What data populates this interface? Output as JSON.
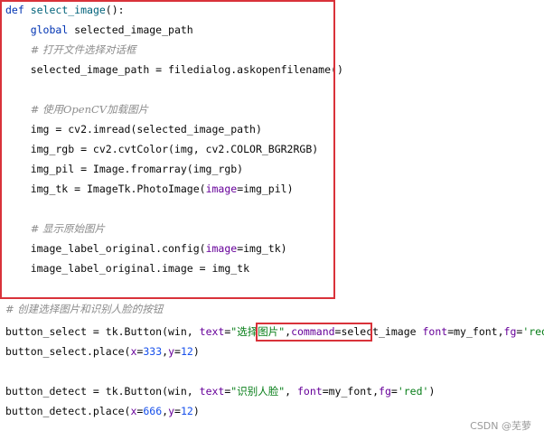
{
  "code_lines": [
    {
      "tokens": [
        {
          "t": "def ",
          "c": "kw"
        },
        {
          "t": "select_image",
          "c": "fn"
        },
        {
          "t": "():",
          "c": ""
        }
      ]
    },
    {
      "tokens": [
        {
          "t": "    ",
          "c": ""
        },
        {
          "t": "global ",
          "c": "kw"
        },
        {
          "t": "selected_image_path",
          "c": ""
        }
      ]
    },
    {
      "tokens": [
        {
          "t": "    ",
          "c": ""
        },
        {
          "t": "# 打开文件选择对话框",
          "c": "cmt"
        }
      ]
    },
    {
      "tokens": [
        {
          "t": "    selected_image_path = filedialog.askopenfilename()",
          "c": ""
        }
      ]
    },
    {
      "tokens": [
        {
          "t": "",
          "c": ""
        }
      ]
    },
    {
      "tokens": [
        {
          "t": "    ",
          "c": ""
        },
        {
          "t": "# 使用OpenCV加载图片",
          "c": "cmt"
        }
      ]
    },
    {
      "tokens": [
        {
          "t": "    img = cv2.imread(selected_image_path)",
          "c": ""
        }
      ]
    },
    {
      "tokens": [
        {
          "t": "    img_rgb = cv2.cvtColor(img, cv2.COLOR_BGR2RGB)",
          "c": ""
        }
      ]
    },
    {
      "tokens": [
        {
          "t": "    img_pil = Image.fromarray(img_rgb)",
          "c": ""
        }
      ]
    },
    {
      "tokens": [
        {
          "t": "    img_tk = ImageTk.PhotoImage(",
          "c": ""
        },
        {
          "t": "image",
          "c": "param"
        },
        {
          "t": "=img_pil)",
          "c": ""
        }
      ]
    },
    {
      "tokens": [
        {
          "t": "",
          "c": ""
        }
      ]
    },
    {
      "tokens": [
        {
          "t": "    ",
          "c": ""
        },
        {
          "t": "# 显示原始图片",
          "c": "cmt"
        }
      ]
    },
    {
      "tokens": [
        {
          "t": "    image_label_original.config(",
          "c": ""
        },
        {
          "t": "image",
          "c": "param"
        },
        {
          "t": "=img_tk)",
          "c": ""
        }
      ]
    },
    {
      "tokens": [
        {
          "t": "    image_label_original.image = img_tk",
          "c": ""
        }
      ]
    },
    {
      "tokens": [
        {
          "t": "",
          "c": ""
        }
      ]
    },
    {
      "tokens": [
        {
          "t": "# 创建选择图片和识别人脸的按钮",
          "c": "cmt"
        }
      ]
    },
    {
      "tokens": [
        {
          "t": "button_select = tk.Button(win, ",
          "c": ""
        },
        {
          "t": "text",
          "c": "param"
        },
        {
          "t": "=",
          "c": ""
        },
        {
          "t": "\"选择图片\"",
          "c": "str"
        },
        {
          "t": ",",
          "c": ""
        },
        {
          "t": "command",
          "c": "param"
        },
        {
          "t": "=select_image",
          "c": ""
        },
        {
          "t": " ",
          "c": ""
        },
        {
          "t": "font",
          "c": "param"
        },
        {
          "t": "=my_font,",
          "c": ""
        },
        {
          "t": "fg",
          "c": "param"
        },
        {
          "t": "=",
          "c": ""
        },
        {
          "t": "'red'",
          "c": "str"
        },
        {
          "t": ")",
          "c": ""
        }
      ]
    },
    {
      "tokens": [
        {
          "t": "button_select.place(",
          "c": ""
        },
        {
          "t": "x",
          "c": "param"
        },
        {
          "t": "=",
          "c": ""
        },
        {
          "t": "333",
          "c": "num"
        },
        {
          "t": ",",
          "c": ""
        },
        {
          "t": "y",
          "c": "param"
        },
        {
          "t": "=",
          "c": ""
        },
        {
          "t": "12",
          "c": "num"
        },
        {
          "t": ")",
          "c": ""
        }
      ]
    },
    {
      "tokens": [
        {
          "t": "",
          "c": ""
        }
      ]
    },
    {
      "tokens": [
        {
          "t": "",
          "c": ""
        }
      ]
    },
    {
      "tokens": [
        {
          "t": "button_detect = tk.Button(win, ",
          "c": ""
        },
        {
          "t": "text",
          "c": "param"
        },
        {
          "t": "=",
          "c": ""
        },
        {
          "t": "\"识别人脸\"",
          "c": "str"
        },
        {
          "t": ", ",
          "c": ""
        },
        {
          "t": "font",
          "c": "param"
        },
        {
          "t": "=my_font,",
          "c": ""
        },
        {
          "t": "fg",
          "c": "param"
        },
        {
          "t": "=",
          "c": ""
        },
        {
          "t": "'red'",
          "c": "str"
        },
        {
          "t": ")",
          "c": ""
        }
      ]
    },
    {
      "tokens": [
        {
          "t": "button_detect.place(",
          "c": ""
        },
        {
          "t": "x",
          "c": "param"
        },
        {
          "t": "=",
          "c": ""
        },
        {
          "t": "666",
          "c": "num"
        },
        {
          "t": ",",
          "c": ""
        },
        {
          "t": "y",
          "c": "param"
        },
        {
          "t": "=",
          "c": ""
        },
        {
          "t": "12",
          "c": "num"
        },
        {
          "t": ")",
          "c": ""
        }
      ]
    }
  ],
  "watermark": "CSDN @芜萝",
  "colors": {
    "highlight_box": "#d9323a",
    "keyword": "#0033b3",
    "comment": "#8c8c8c",
    "string": "#067d17",
    "number": "#1750eb",
    "param": "#660099"
  }
}
